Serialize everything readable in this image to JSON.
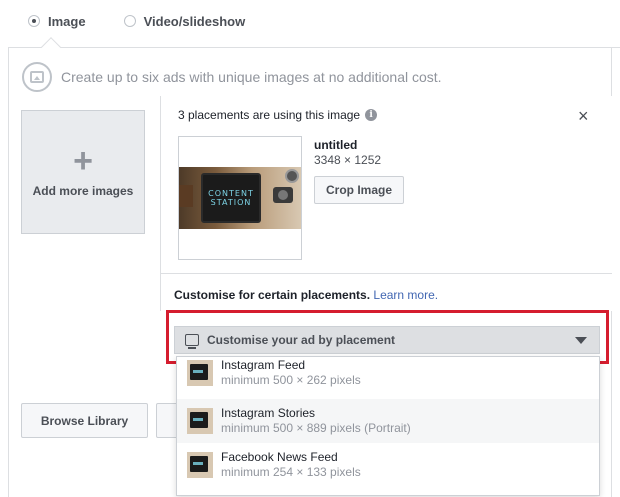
{
  "media_type": {
    "options": [
      {
        "label": "Image",
        "selected": true
      },
      {
        "label": "Video/slideshow",
        "selected": false
      }
    ]
  },
  "info": {
    "text": "Create up to six ads with unique images at no additional cost.",
    "icon": "image-icon"
  },
  "add_tile": {
    "plus": "+",
    "label": "Add more images"
  },
  "image_card": {
    "placements_text": "3 placements are using this image",
    "info_badge": "i",
    "close": "×",
    "image": {
      "name": "untitled",
      "dims": "3348 × 1252",
      "thumb_text_line1": "CONTENT",
      "thumb_text_line2": "STATION"
    },
    "crop_label": "Crop Image"
  },
  "customise": {
    "text": "Customise for certain placements.",
    "link": "Learn more.",
    "dropdown_label": "Customise your ad by placement"
  },
  "menu": {
    "items": [
      {
        "title": "Instagram Feed",
        "sub": "minimum 500 × 262 pixels"
      },
      {
        "title": "Instagram Stories",
        "sub": "minimum 500 × 889 pixels (Portrait)"
      },
      {
        "title": "Facebook News Feed",
        "sub": "minimum 254 × 133 pixels"
      }
    ]
  },
  "footer": {
    "browse_label": "Browse Library"
  },
  "colors": {
    "highlight": "#d51d2e",
    "link": "#4267b2"
  }
}
